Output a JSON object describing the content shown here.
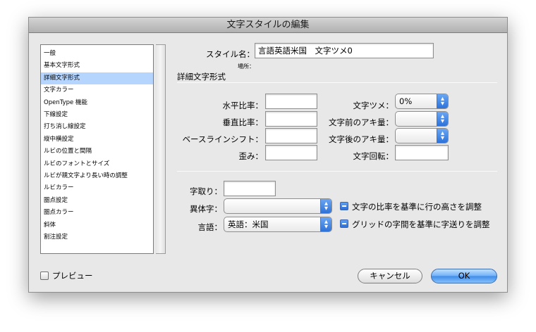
{
  "dialog": {
    "title": "文字スタイルの編集"
  },
  "list": {
    "items": [
      {
        "label": "一般"
      },
      {
        "label": "基本文字形式"
      },
      {
        "label": "詳細文字形式",
        "selected": true
      },
      {
        "label": "文字カラー"
      },
      {
        "label": "OpenType 機能"
      },
      {
        "label": "下線設定"
      },
      {
        "label": "打ち消し線設定"
      },
      {
        "label": "縦中横設定"
      },
      {
        "label": "ルビの位置と間隔"
      },
      {
        "label": "ルビのフォントとサイズ"
      },
      {
        "label": "ルビが親文字より長い時の調整"
      },
      {
        "label": "ルビカラー"
      },
      {
        "label": "圏点設定"
      },
      {
        "label": "圏点カラー"
      },
      {
        "label": "斜体"
      },
      {
        "label": "割注設定"
      }
    ]
  },
  "style_name": {
    "label": "スタイル名：",
    "value": "言語英語米国　文字ツメ0"
  },
  "location": {
    "label": "場所："
  },
  "section": {
    "title": "詳細文字形式"
  },
  "fields": {
    "horizontal_scale": {
      "label": "水平比率：",
      "value": ""
    },
    "vertical_scale": {
      "label": "垂直比率：",
      "value": ""
    },
    "baseline_shift": {
      "label": "ベースラインシフト：",
      "value": ""
    },
    "skew": {
      "label": "歪み：",
      "value": ""
    },
    "tsume": {
      "label": "文字ツメ：",
      "value": "0%"
    },
    "aki_before": {
      "label": "文字前のアキ量：",
      "value": ""
    },
    "aki_after": {
      "label": "文字後のアキ量：",
      "value": ""
    },
    "char_rotation": {
      "label": "文字回転：",
      "value": ""
    },
    "mojidori": {
      "label": "字取り：",
      "value": ""
    },
    "variant": {
      "label": "異体字：",
      "value": ""
    },
    "language": {
      "label": "言語：",
      "value": "英語：米国"
    }
  },
  "checkboxes": {
    "ratio_line_height": {
      "label": "文字の比率を基準に行の高さを調整",
      "state": "mixed"
    },
    "grid_tracking": {
      "label": "グリッドの字間を基準に字送りを調整",
      "state": "mixed"
    },
    "preview": {
      "label": "プレビュー",
      "state": "unchecked"
    }
  },
  "buttons": {
    "cancel": "キャンセル",
    "ok": "OK"
  },
  "colors": {
    "selection": "#b5d5fe",
    "accent": "#2d72d9"
  }
}
